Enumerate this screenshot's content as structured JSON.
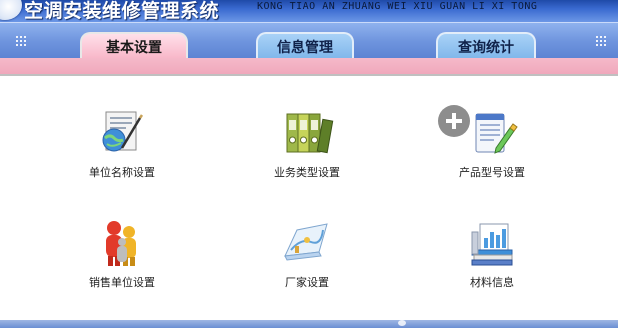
{
  "header": {
    "title": "空调安装维修管理系统",
    "subtitle": "KONG TIAO AN ZHUANG WEI XIU  GUAN LI XI TONG"
  },
  "tabs": [
    {
      "label": "基本设置",
      "active": true
    },
    {
      "label": "信息管理",
      "active": false
    },
    {
      "label": "查询统计",
      "active": false
    }
  ],
  "items": [
    {
      "label": "单位名称设置",
      "icon": "document-globe-icon"
    },
    {
      "label": "业务类型设置",
      "icon": "binders-icon"
    },
    {
      "label": "产品型号设置",
      "icon": "notepad-pen-icon"
    },
    {
      "label": "销售单位设置",
      "icon": "people-icon"
    },
    {
      "label": "厂家设置",
      "icon": "map-scroll-icon"
    },
    {
      "label": "材料信息",
      "icon": "books-chart-icon"
    }
  ],
  "overlay": {
    "icon": "plus-circle-icon"
  },
  "colors": {
    "header_blue": "#3a6ad0",
    "tab_bar_blue": "#6f95de",
    "active_tab_pink": "#f8b6c8",
    "inactive_tab_blue": "#7fb6ea",
    "pink_band": "#f0a8bc"
  }
}
